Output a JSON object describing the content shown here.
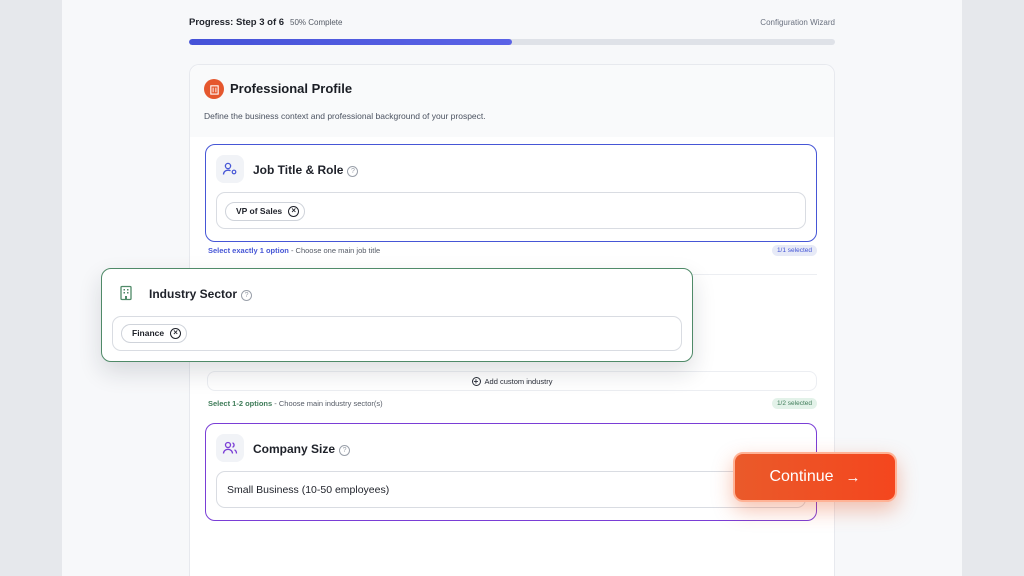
{
  "progress": {
    "step_label": "Progress: Step 3 of 6",
    "percent_label": "50% Complete",
    "percent": 0.5,
    "wizard_label": "Configuration Wizard"
  },
  "profile": {
    "title": "Professional Profile",
    "description": "Define the business context and professional background of your prospect."
  },
  "job": {
    "title": "Job Title & Role",
    "chip": "VP of Sales",
    "hint_bold": "Select exactly 1 option",
    "hint_rest": " - Choose one main job title",
    "badge": "1/1 selected"
  },
  "industry": {
    "title": "Industry Sector",
    "chip": "Finance",
    "add_custom": "Add custom industry",
    "hint_bold": "Select 1-2 options",
    "hint_rest": " - Choose main industry sector(s)",
    "badge": "1/2 selected"
  },
  "company": {
    "title": "Company Size",
    "value": "Small Business (10-50 employees)"
  },
  "continue_label": "Continue",
  "colors": {
    "accent_blue": "#4656d6",
    "accent_green": "#4f8a68",
    "accent_purple": "#7a3ed6",
    "cta_orange": "#f04f22"
  }
}
